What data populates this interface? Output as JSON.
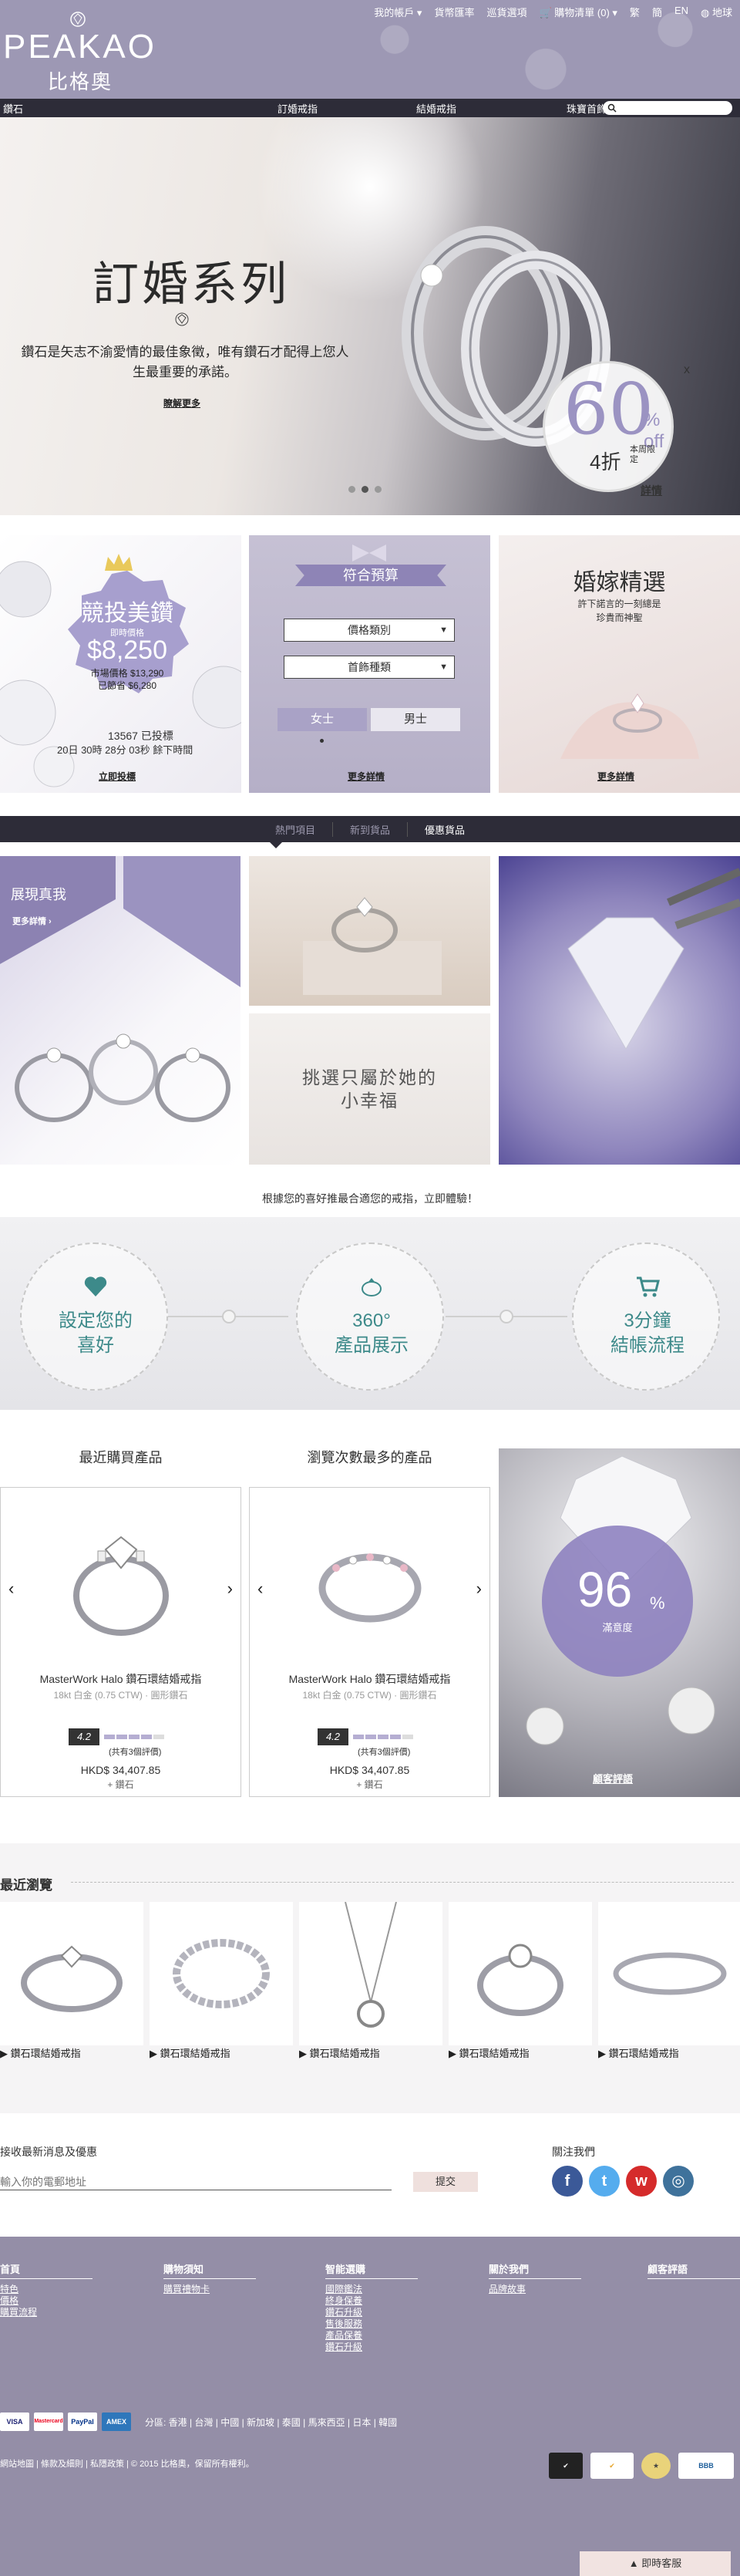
{
  "header": {
    "brand_en": "PEAKAO",
    "brand_zh": "比格奧",
    "top_links": [
      "我的帳戶 ▾",
      "貨幣匯率",
      "巡貨選項",
      "購物清單 (0) ▾",
      "繁",
      "簡",
      "EN",
      "地球"
    ]
  },
  "nav": {
    "items": [
      "鑽石",
      "訂婚戒指",
      "結婚戒指",
      "珠寶首飾"
    ]
  },
  "hero": {
    "title": "訂婚系列",
    "desc": "鑽石是矢志不渝愛情的最佳象徵，唯有鑽石才配得上您人生最重要的承諾。",
    "more": "瞭解更多",
    "promo_big": "60",
    "promo_pct": "% off",
    "promo_zhe": "4折",
    "promo_tag": "本周限定",
    "promo_link": "詳情",
    "close": "x"
  },
  "card1": {
    "title": "競投美鑽",
    "sub": "即時價格",
    "price": "$8,250",
    "market": "市場價格 $13,290",
    "saved": "已節省 $6,280",
    "bids": "13567  已投標",
    "time": "20日 30時 28分 03秒  餘下時間",
    "link": "立即投標"
  },
  "card2": {
    "ribbon": "符合預算",
    "select1": "價格類別",
    "select2": "首飾種類",
    "female": "女士",
    "male": "男士",
    "link": "更多詳情"
  },
  "card3": {
    "title": "婚嫁精選",
    "desc1": "許下諾言的一刻總是",
    "desc2": "珍貴而神聖",
    "link": "更多詳情"
  },
  "tabs": [
    "熱門項目",
    "新到貨品",
    "優惠貨品"
  ],
  "gallery": {
    "g1_title": "展現真我",
    "g1_more": "更多詳情 ›",
    "g3_text1": "挑選只屬於她的",
    "g3_text2": "小幸福"
  },
  "recommend": "根據您的喜好推最合適您的戒指，立即體驗！",
  "features": [
    {
      "line1": "設定您的",
      "line2": "喜好"
    },
    {
      "line1": "360°",
      "line2": "產品展示"
    },
    {
      "line1": "3分鐘",
      "line2": "結帳流程"
    }
  ],
  "products": {
    "recent_title": "最近購買產品",
    "popular_title": "瀏覽次數最多的產品",
    "items": [
      {
        "name": "MasterWork Halo 鑽石環結婚戒指",
        "spec": "18kt 白金 (0.75 CTW) · 圓形鑽石",
        "score": "4.2",
        "reviews": "(共有3個評價)",
        "price": "HKD$ 34,407.85",
        "plus": "+ 鑽石"
      },
      {
        "name": "MasterWork Halo 鑽石環結婚戒指",
        "spec": "18kt 白金 (0.75 CTW) · 圓形鑽石",
        "score": "4.2",
        "reviews": "(共有3個評價)",
        "price": "HKD$ 34,407.85",
        "plus": "+ 鑽石"
      }
    ],
    "rating_fill": 4.2,
    "satisfaction_value": "96",
    "satisfaction_pct": "%",
    "satisfaction_label": "滿意度",
    "satisfaction_link": "顧客評語"
  },
  "recent": {
    "title": "最近瀏覽",
    "items": [
      "鑽石環結婚戒指",
      "鑽石環結婚戒指",
      "鑽石環結婚戒指",
      "鑽石環結婚戒指",
      "鑽石環結婚戒指"
    ]
  },
  "newsletter": {
    "title": "接收最新消息及優惠",
    "placeholder": "輸入你的電郵地址",
    "button": "提交",
    "follow": "關注我們"
  },
  "footer": {
    "col1": {
      "title": "首頁",
      "items": [
        "特色",
        "價格",
        "購買流程"
      ]
    },
    "col2": {
      "title": "購物須知",
      "items": [
        "購買禮物卡"
      ]
    },
    "col3": {
      "title": "智能選購",
      "items": [
        "國際鑑法",
        "終身保養",
        "鑽石升級",
        "售後服務",
        "產品保養",
        "鑽石升級"
      ]
    },
    "col4": {
      "title": "關於我們",
      "items": [
        "品牌故事"
      ]
    },
    "col5": {
      "title": "顧客評語",
      "items": []
    },
    "payments": [
      "VISA",
      "Mastercard",
      "PayPal",
      "AMEX"
    ],
    "regions": "分區: 香港 | 台灣 | 中國 | 新加坡 | 泰國 | 馬來西亞 | 日本 | 韓國",
    "copyright": "網站地圖 | 條款及細則 | 私隱政策 | © 2015 比格奧，保留所有權利。",
    "chat": "▲ 即時客服"
  },
  "colors": {
    "accent": "#9b93c2",
    "header": "#9d98b4",
    "nav": "#2d2c38",
    "footer": "#948ea7",
    "teal": "#3d8a8a"
  }
}
